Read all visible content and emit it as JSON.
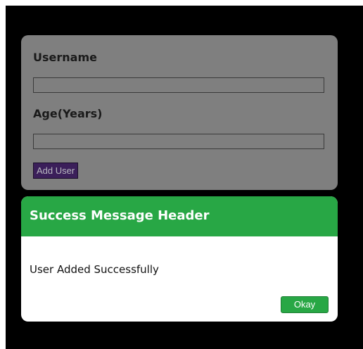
{
  "form": {
    "username_label": "Username",
    "username_value": "",
    "age_label": "Age(Years)",
    "age_value": "",
    "add_button_label": "Add User"
  },
  "modal": {
    "title": "Success Message Header",
    "message": "User Added Successfully",
    "okay_button_label": "Okay"
  },
  "colors": {
    "backdrop": "#000000",
    "form_card": "#7f7f7f",
    "add_button": "#3b1f5a",
    "modal_header": "#28a745",
    "okay_button": "#28a745"
  }
}
